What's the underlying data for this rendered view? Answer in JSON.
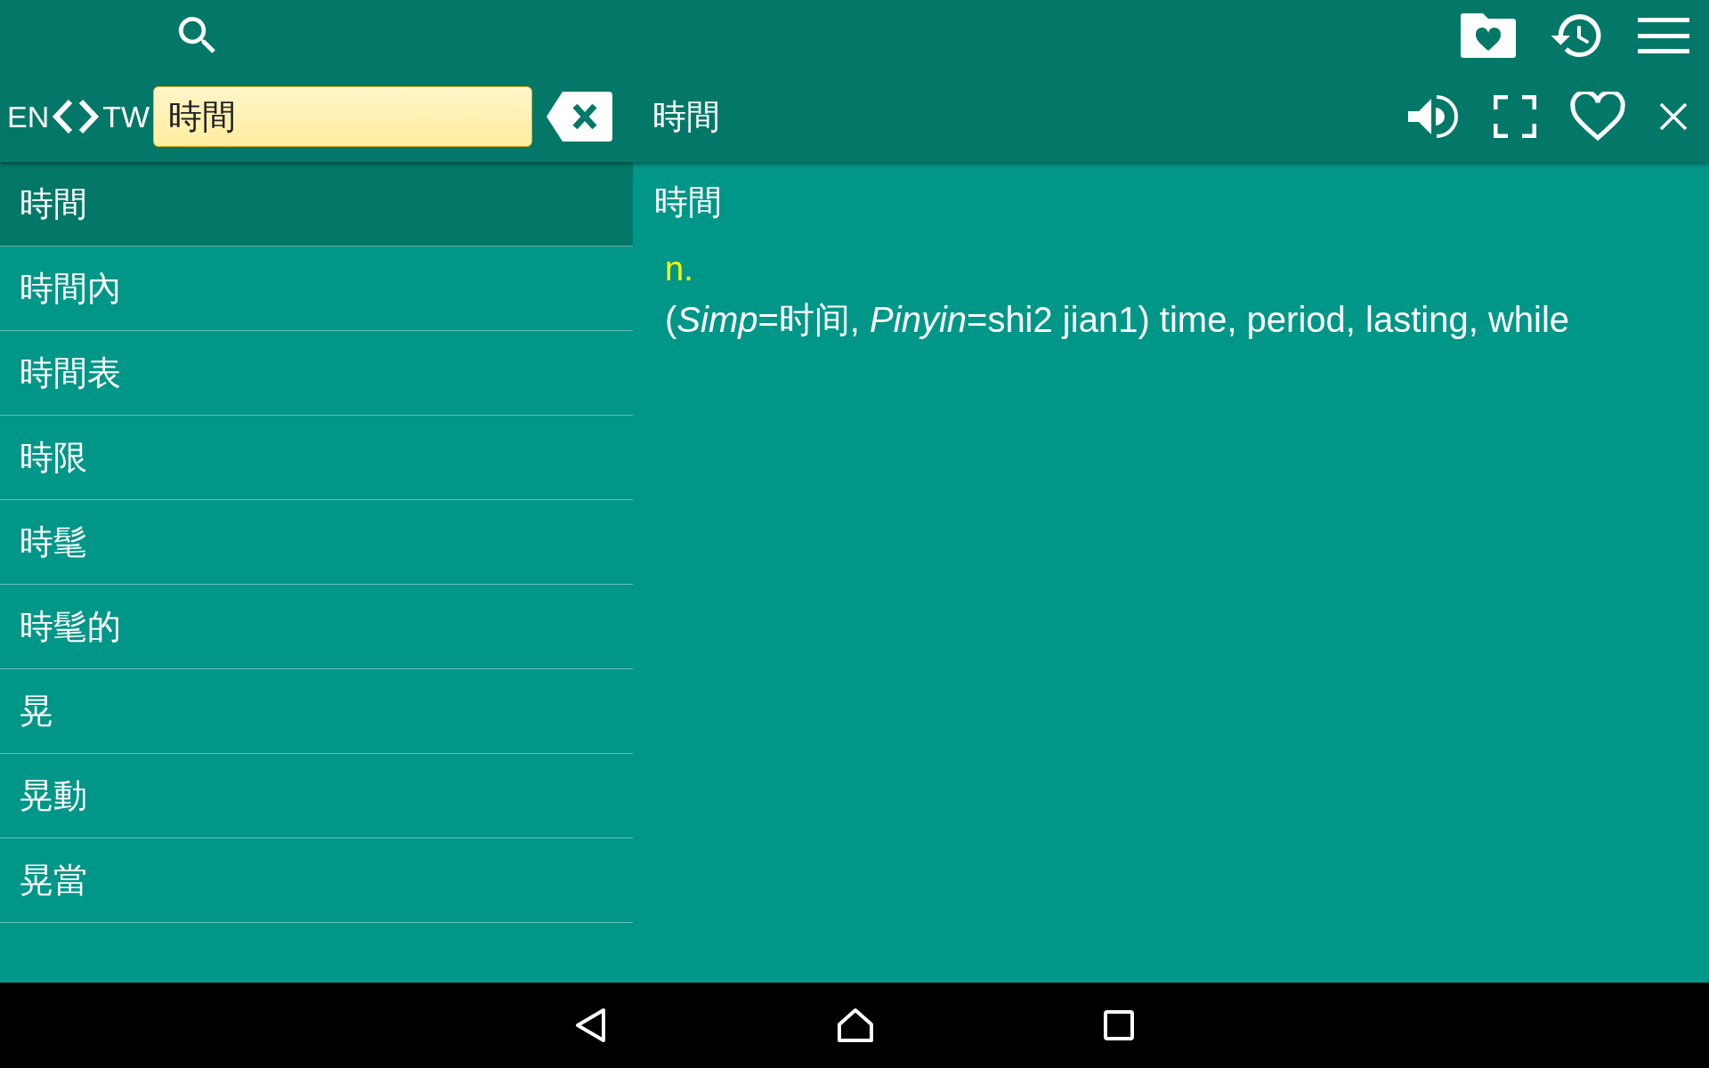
{
  "header": {
    "lang_from": "EN",
    "lang_to": "TW",
    "search": {
      "value": "時間"
    },
    "entry_title": "時間"
  },
  "word_list": [
    {
      "word": "時間",
      "selected": true
    },
    {
      "word": "時間內",
      "selected": false
    },
    {
      "word": "時間表",
      "selected": false
    },
    {
      "word": "時限",
      "selected": false
    },
    {
      "word": "時髦",
      "selected": false
    },
    {
      "word": "時髦的",
      "selected": false
    },
    {
      "word": "晃",
      "selected": false
    },
    {
      "word": "晃動",
      "selected": false
    },
    {
      "word": "晃當",
      "selected": false
    }
  ],
  "entry": {
    "headword": "時間",
    "part_of_speech": "n.",
    "definition": "(*Simp*=时间, *Pinyin*=shi2 jian1) time, period, lasting, while"
  }
}
